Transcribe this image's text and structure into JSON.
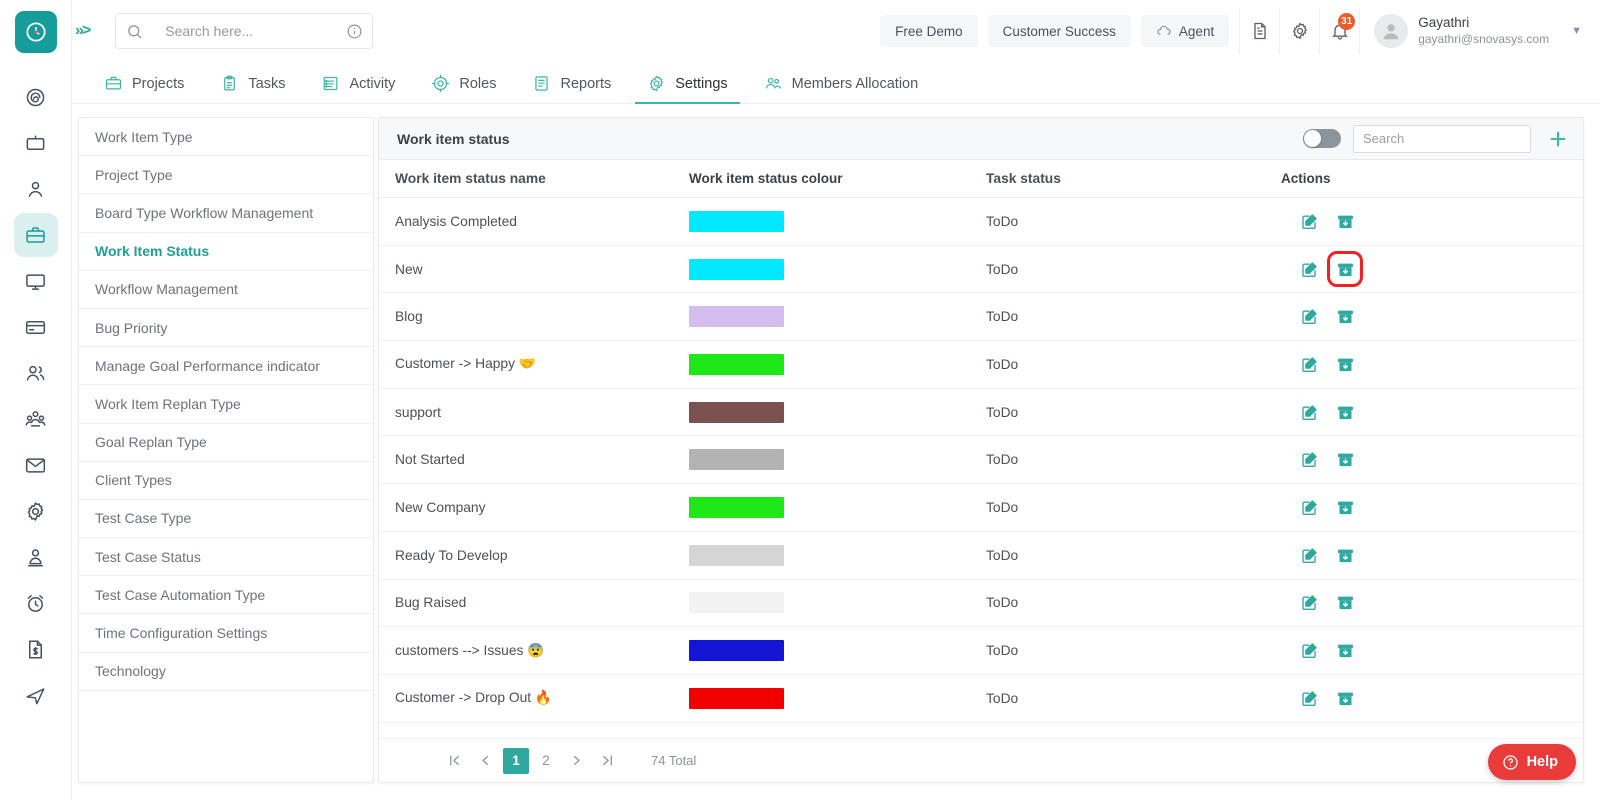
{
  "brand": {
    "logo_icon": "clock-logo-icon",
    "accent": "#179c9c",
    "collapse_icon": "double-chevron-right-icon"
  },
  "search": {
    "placeholder": "Search here...",
    "value": "",
    "icon": "search-icon",
    "info_icon": "info-circle-icon"
  },
  "topbar": {
    "free_demo_label": "Free Demo",
    "customer_success_label": "Customer Success",
    "agent_label": "Agent",
    "agent_icon": "cloud-download-icon",
    "doc_icon": "document-icon",
    "settings_icon": "gear-icon",
    "bell_icon": "bell-icon",
    "notification_count": "31",
    "user_name": "Gayathri",
    "user_email": "gayathri@snovasys.com",
    "avatar_icon": "user-avatar-icon",
    "caret_icon": "chevron-down-icon"
  },
  "rail": {
    "items": [
      {
        "name": "dashboard-spiral-icon",
        "active": false
      },
      {
        "name": "tv-board-icon",
        "active": false
      },
      {
        "name": "person-icon",
        "active": false
      },
      {
        "name": "briefcase-icon",
        "active": true
      },
      {
        "name": "monitor-icon",
        "active": false
      },
      {
        "name": "card-icon",
        "active": false
      },
      {
        "name": "two-people-icon",
        "active": false
      },
      {
        "name": "group-people-icon",
        "active": false
      },
      {
        "name": "mail-icon",
        "active": false
      },
      {
        "name": "gear-icon",
        "active": false
      },
      {
        "name": "user-badge-icon",
        "active": false
      },
      {
        "name": "alarm-clock-icon",
        "active": false
      },
      {
        "name": "invoice-icon",
        "active": false
      },
      {
        "name": "send-icon",
        "active": false
      }
    ]
  },
  "nav": {
    "tabs": [
      {
        "label": "Projects",
        "icon": "briefcase-icon",
        "active": false
      },
      {
        "label": "Tasks",
        "icon": "clipboard-icon",
        "active": false
      },
      {
        "label": "Activity",
        "icon": "list-icon",
        "active": false
      },
      {
        "label": "Roles",
        "icon": "target-icon",
        "active": false
      },
      {
        "label": "Reports",
        "icon": "report-icon",
        "active": false
      },
      {
        "label": "Settings",
        "icon": "gear-icon",
        "active": true
      },
      {
        "label": "Members Allocation",
        "icon": "people-icon",
        "active": false
      }
    ]
  },
  "submenu": {
    "items": [
      {
        "label": "Work Item Type",
        "active": false
      },
      {
        "label": "Project Type",
        "active": false
      },
      {
        "label": "Board Type Workflow Management",
        "active": false
      },
      {
        "label": "Work Item Status",
        "active": true
      },
      {
        "label": "Workflow Management",
        "active": false
      },
      {
        "label": "Bug Priority",
        "active": false
      },
      {
        "label": "Manage Goal Performance indicator",
        "active": false
      },
      {
        "label": "Work Item Replan Type",
        "active": false
      },
      {
        "label": "Goal Replan Type",
        "active": false
      },
      {
        "label": "Client Types",
        "active": false
      },
      {
        "label": "Test Case Type",
        "active": false
      },
      {
        "label": "Test Case Status",
        "active": false
      },
      {
        "label": "Test Case Automation Type",
        "active": false
      },
      {
        "label": "Time Configuration Settings",
        "active": false
      },
      {
        "label": "Technology",
        "active": false
      }
    ]
  },
  "panel": {
    "title": "Work item status",
    "toggle_on": false,
    "search_placeholder": "Search",
    "search_value": "",
    "add_icon": "plus-icon",
    "columns": [
      "Work item status name",
      "Work item status colour",
      "Task status",
      "Actions"
    ],
    "rows": [
      {
        "name": "Analysis Completed",
        "colour": "#00e9ff",
        "task_status": "ToDo",
        "edit_icon": "edit-pencil-icon",
        "archive_icon": "archive-download-icon",
        "highlighted": false
      },
      {
        "name": "New",
        "colour": "#00e9ff",
        "task_status": "ToDo",
        "edit_icon": "edit-pencil-icon",
        "archive_icon": "archive-download-icon",
        "highlighted": true
      },
      {
        "name": "Blog",
        "colour": "#d3bdee",
        "task_status": "ToDo",
        "edit_icon": "edit-pencil-icon",
        "archive_icon": "archive-download-icon",
        "highlighted": false
      },
      {
        "name": "Customer -> Happy 🤝",
        "colour": "#1fe818",
        "task_status": "ToDo",
        "edit_icon": "edit-pencil-icon",
        "archive_icon": "archive-download-icon",
        "highlighted": false
      },
      {
        "name": "support",
        "colour": "#7b5050",
        "task_status": "ToDo",
        "edit_icon": "edit-pencil-icon",
        "archive_icon": "archive-download-icon",
        "highlighted": false
      },
      {
        "name": "Not Started",
        "colour": "#b3b3b3",
        "task_status": "ToDo",
        "edit_icon": "edit-pencil-icon",
        "archive_icon": "archive-download-icon",
        "highlighted": false
      },
      {
        "name": "New Company",
        "colour": "#1fe818",
        "task_status": "ToDo",
        "edit_icon": "edit-pencil-icon",
        "archive_icon": "archive-download-icon",
        "highlighted": false
      },
      {
        "name": "Ready To Develop",
        "colour": "#d5d5d5",
        "task_status": "ToDo",
        "edit_icon": "edit-pencil-icon",
        "archive_icon": "archive-download-icon",
        "highlighted": false
      },
      {
        "name": "Bug Raised",
        "colour": "#f2f2f2",
        "task_status": "ToDo",
        "edit_icon": "edit-pencil-icon",
        "archive_icon": "archive-download-icon",
        "highlighted": false
      },
      {
        "name": "customers --> Issues 😨",
        "colour": "#1414d4",
        "task_status": "ToDo",
        "edit_icon": "edit-pencil-icon",
        "archive_icon": "archive-download-icon",
        "highlighted": false
      },
      {
        "name": "Customer -> Drop Out 🔥",
        "colour": "#f00000",
        "task_status": "ToDo",
        "edit_icon": "edit-pencil-icon",
        "archive_icon": "archive-download-icon",
        "highlighted": false
      }
    ]
  },
  "pagination": {
    "first_icon": "first-page-icon",
    "prev_icon": "prev-page-icon",
    "pages": [
      "1",
      "2"
    ],
    "current_page": "1",
    "next_icon": "next-page-icon",
    "last_icon": "last-page-icon",
    "total_label": "74 Total"
  },
  "help": {
    "label": "Help",
    "icon": "question-circle-icon",
    "color": "#ea3b3b"
  }
}
